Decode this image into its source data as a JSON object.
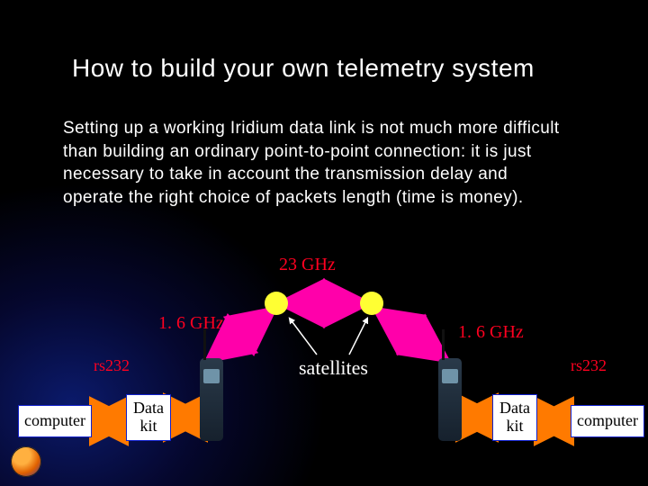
{
  "title": "How to build your own telemetry system",
  "body": "Setting up a working Iridium data link is not much more difficult than building an ordinary point-to-point connection: it is just necessary to take in account the transmission delay and operate the right choice of packets length (time is money).",
  "labels": {
    "freq_intersat": "23 GHz",
    "freq_uplink_left": "1. 6 GHz",
    "freq_uplink_right": "1. 6 GHz",
    "rs_left": "rs232",
    "rs_right": "rs232",
    "satellites": "satellites"
  },
  "nodes": {
    "computer_left": "computer",
    "computer_right": "computer",
    "datakit_left": "Data\nkit",
    "datakit_right": "Data\nkit"
  },
  "colors": {
    "accent_red": "#ff0020",
    "arrow_magenta": "#ff00aa",
    "arrow_orange": "#ff7a00",
    "sat_yellow": "#ffff33"
  }
}
